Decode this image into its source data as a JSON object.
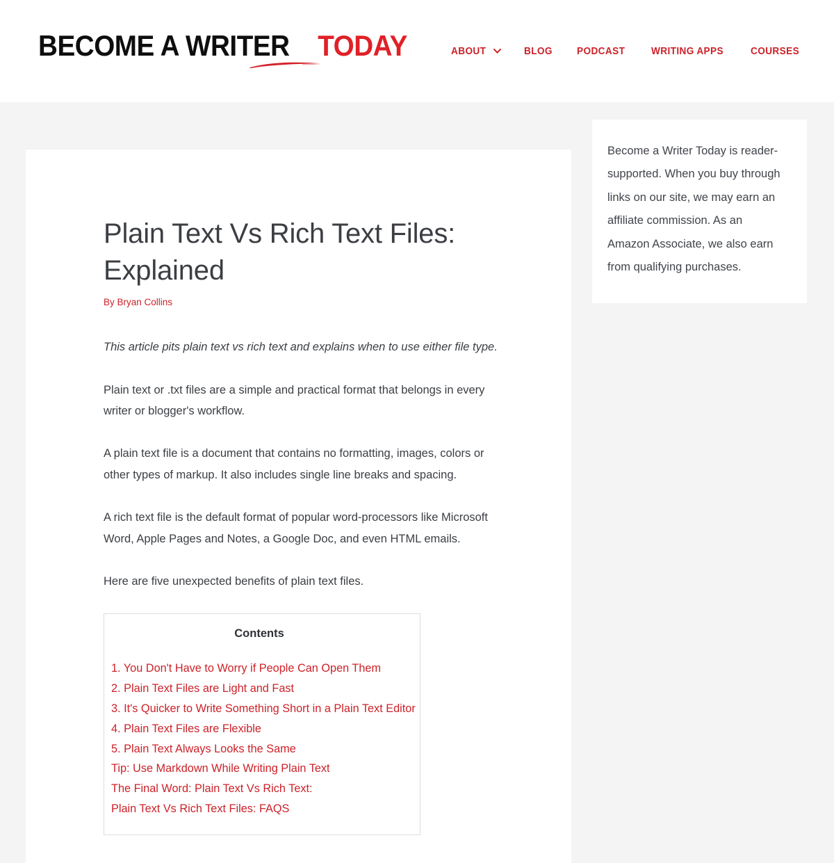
{
  "header": {
    "logo": {
      "part1": "BECOME A WRITER",
      "part2": "TODAY",
      "swoosh_icon": "brush-underline-icon",
      "black": "#0e0e0e",
      "red": "#e02027"
    },
    "nav": {
      "accent": "#cc2229",
      "items": [
        {
          "label": "ABOUT",
          "has_dropdown": true,
          "icon": "chevron-down-icon"
        },
        {
          "label": "BLOG",
          "has_dropdown": false
        },
        {
          "label": "PODCAST",
          "has_dropdown": false
        },
        {
          "label": "WRITING APPS",
          "has_dropdown": false
        },
        {
          "label": "COURSES",
          "has_dropdown": false
        }
      ]
    }
  },
  "article": {
    "title": "Plain Text Vs Rich Text Files: Explained",
    "byline_prefix": "By ",
    "author": "Bryan Collins",
    "paragraphs": [
      {
        "style": "italic",
        "text": "This article pits plain text vs rich text and explains when to use either file type."
      },
      {
        "style": "normal",
        "text": "Plain text or .txt files are a simple and practical format that belongs in every writer or blogger's workflow."
      },
      {
        "style": "normal",
        "text": "A plain text file is a document that contains no formatting, images, colors or other types of markup. It also includes single line breaks and spacing."
      },
      {
        "style": "normal",
        "text": "A rich text file is the default format of popular word-processors like Microsoft Word, Apple Pages and Notes, a Google Doc, and even HTML emails."
      },
      {
        "style": "normal",
        "text": "Here are five unexpected benefits of plain text files."
      }
    ],
    "contents": {
      "title": "Contents",
      "items": [
        "1. You Don't Have to Worry if People Can Open Them",
        "2. Plain Text Files are Light and Fast",
        "3. It's Quicker to Write Something Short in a Plain Text Editor",
        "4. Plain Text Files are Flexible",
        "5. Plain Text Always Looks the Same",
        "Tip: Use Markdown While Writing Plain Text",
        "The Final Word: Plain Text Vs Rich Text:",
        "Plain Text Vs Rich Text Files: FAQS"
      ]
    }
  },
  "sidebar": {
    "disclaimer": "Become a Writer Today is reader-supported. When you buy through links on our site, we may earn an affiliate commission. As an Amazon Associate, we also earn from qualifying purchases."
  },
  "theme": {
    "page_background": "#f4f4f4",
    "card_background": "#ffffff",
    "accent_red": "#cc2229",
    "text": "#3b3e43",
    "border": "#dcdcdc"
  }
}
